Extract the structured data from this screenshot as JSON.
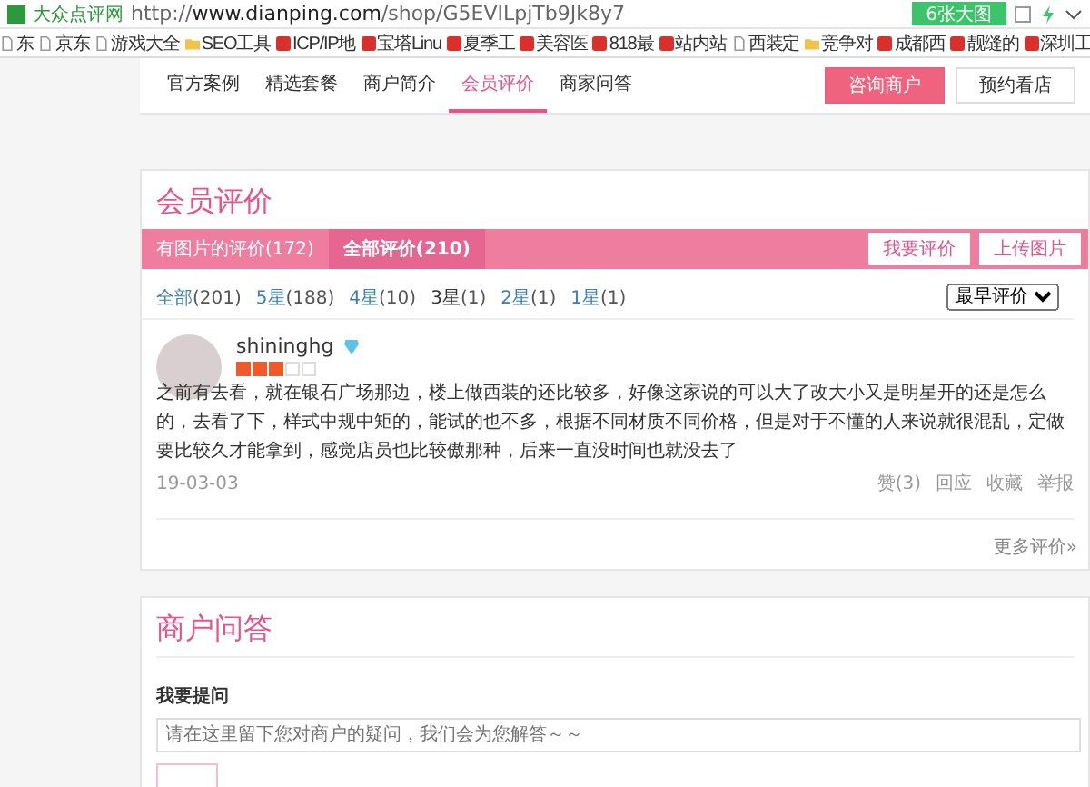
{
  "browser": {
    "site_label": "大众点评网",
    "url_prefix": "http://",
    "url_host": "www.dianping.com",
    "url_path": "/shop/G5EVILpjTb9Jk8y7",
    "image_button": "6张大图",
    "bookmarks": [
      {
        "label": "东",
        "kind": "page"
      },
      {
        "label": "京东",
        "kind": "page"
      },
      {
        "label": "游戏大全",
        "kind": "page"
      },
      {
        "label": "SEO工具",
        "kind": "folder"
      },
      {
        "label": "ICP/IP地",
        "kind": "site"
      },
      {
        "label": "宝塔Linu",
        "kind": "site"
      },
      {
        "label": "夏季工",
        "kind": "site"
      },
      {
        "label": "美容医",
        "kind": "site"
      },
      {
        "label": "818最",
        "kind": "site"
      },
      {
        "label": "站内站",
        "kind": "site"
      },
      {
        "label": "西装定",
        "kind": "page"
      },
      {
        "label": "竞争对",
        "kind": "folder"
      },
      {
        "label": "成都西",
        "kind": "site"
      },
      {
        "label": "靓缝的",
        "kind": "site"
      },
      {
        "label": "深圳工",
        "kind": "site"
      }
    ]
  },
  "nav": {
    "tabs": [
      {
        "label": "官方案例",
        "selected": false
      },
      {
        "label": "精选套餐",
        "selected": false
      },
      {
        "label": "商户简介",
        "selected": false
      },
      {
        "label": "会员评价",
        "selected": true
      },
      {
        "label": "商家问答",
        "selected": false
      }
    ],
    "buttons": [
      {
        "label": "咨询商户",
        "kind": "primary"
      },
      {
        "label": "预约看店",
        "kind": "secondary"
      }
    ]
  },
  "reviews": {
    "title": "会员评价",
    "tabs": [
      {
        "label": "有图片的评价(172)",
        "selected": false
      },
      {
        "label": "全部评价(210)",
        "selected": true
      }
    ],
    "actions": [
      "我要评价",
      "上传图片"
    ],
    "filters": [
      {
        "label": "全部",
        "count": "(201)",
        "selected": false
      },
      {
        "label": "5星",
        "count": "(188)",
        "selected": false
      },
      {
        "label": "4星",
        "count": "(10)",
        "selected": false
      },
      {
        "label": "3星",
        "count": "(1)",
        "selected": true
      },
      {
        "label": "2星",
        "count": "(1)",
        "selected": false
      },
      {
        "label": "1星",
        "count": "(1)",
        "selected": false
      }
    ],
    "sort": "最早评价",
    "review": {
      "user": "shininghg",
      "stars": 3,
      "text": "之前有去看，就在银石广场那边，楼上做西装的还比较多，好像这家说的可以大了改大小又是明星开的还是怎么的，去看了下，样式中规中矩的，能试的也不多，根据不同材质不同价格，但是对于不懂的人来说就很混乱，定做要比较久才能拿到，感觉店员也比较傲那种，后来一直没时间也就没去了",
      "date": "19-03-03",
      "actions": [
        "赞(3)",
        "回应",
        "收藏",
        "举报"
      ]
    },
    "more": "更多评价»"
  },
  "qa": {
    "title": "商户问答",
    "ask_label": "我要提问",
    "placeholder": "请在这里留下您对商户的疑问，我们会为您解答～～"
  }
}
